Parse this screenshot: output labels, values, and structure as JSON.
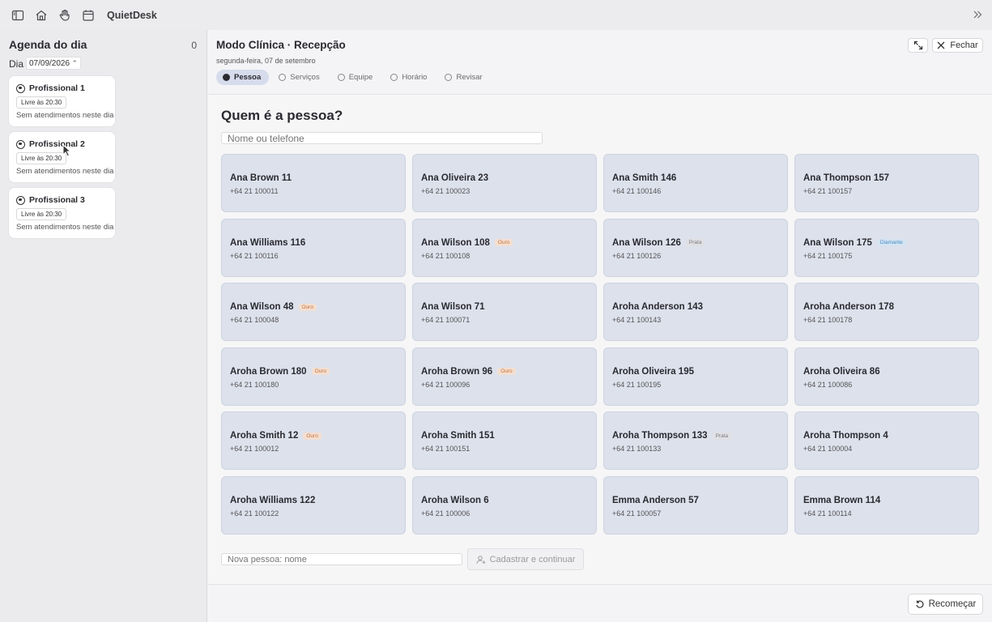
{
  "app": {
    "name": "QuietDesk"
  },
  "topbar_icons": [
    "sidebar-toggle-icon",
    "home-icon",
    "hand-icon",
    "calendar-icon",
    "chevrons-right-icon"
  ],
  "sidebar": {
    "title": "Agenda do dia",
    "count": "0",
    "day_label": "Dia",
    "day_value": "07/09/2026",
    "professionals": [
      {
        "name": "Profissional 1",
        "badge": "Livre às 20:30",
        "status": "Sem atendimentos neste dia"
      },
      {
        "name": "Profissional 2",
        "badge": "Livre às 20:30",
        "status": "Sem atendimentos neste dia"
      },
      {
        "name": "Profissional 3",
        "badge": "Livre às 20:30",
        "status": "Sem atendimentos neste dia"
      }
    ]
  },
  "main": {
    "title": "Modo Clínica · Recepção",
    "date": "segunda-feira, 07 de setembro",
    "close_label": "Fechar",
    "steps": [
      {
        "label": "Pessoa",
        "active": true
      },
      {
        "label": "Serviços",
        "active": false
      },
      {
        "label": "Equipe",
        "active": false
      },
      {
        "label": "Horário",
        "active": false
      },
      {
        "label": "Revisar",
        "active": false
      }
    ],
    "question": "Quem é a pessoa?",
    "search_placeholder": "Nome ou telefone",
    "people": [
      {
        "name": "Ana Brown 11",
        "phone": "+64 21 100011",
        "tier": ""
      },
      {
        "name": "Ana Oliveira 23",
        "phone": "+64 21 100023",
        "tier": ""
      },
      {
        "name": "Ana Smith 146",
        "phone": "+64 21 100146",
        "tier": ""
      },
      {
        "name": "Ana Thompson 157",
        "phone": "+64 21 100157",
        "tier": ""
      },
      {
        "name": "Ana Williams 116",
        "phone": "+64 21 100116",
        "tier": ""
      },
      {
        "name": "Ana Wilson 108",
        "phone": "+64 21 100108",
        "tier": "Ouro"
      },
      {
        "name": "Ana Wilson 126",
        "phone": "+64 21 100126",
        "tier": "Prata"
      },
      {
        "name": "Ana Wilson 175",
        "phone": "+64 21 100175",
        "tier": "Diamante"
      },
      {
        "name": "Ana Wilson 48",
        "phone": "+64 21 100048",
        "tier": "Ouro"
      },
      {
        "name": "Ana Wilson 71",
        "phone": "+64 21 100071",
        "tier": ""
      },
      {
        "name": "Aroha Anderson 143",
        "phone": "+64 21 100143",
        "tier": ""
      },
      {
        "name": "Aroha Anderson 178",
        "phone": "+64 21 100178",
        "tier": ""
      },
      {
        "name": "Aroha Brown 180",
        "phone": "+64 21 100180",
        "tier": "Ouro"
      },
      {
        "name": "Aroha Brown 96",
        "phone": "+64 21 100096",
        "tier": "Ouro"
      },
      {
        "name": "Aroha Oliveira 195",
        "phone": "+64 21 100195",
        "tier": ""
      },
      {
        "name": "Aroha Oliveira 86",
        "phone": "+64 21 100086",
        "tier": ""
      },
      {
        "name": "Aroha Smith 12",
        "phone": "+64 21 100012",
        "tier": "Ouro"
      },
      {
        "name": "Aroha Smith 151",
        "phone": "+64 21 100151",
        "tier": ""
      },
      {
        "name": "Aroha Thompson 133",
        "phone": "+64 21 100133",
        "tier": "Prata"
      },
      {
        "name": "Aroha Thompson 4",
        "phone": "+64 21 100004",
        "tier": ""
      },
      {
        "name": "Aroha Williams 122",
        "phone": "+64 21 100122",
        "tier": ""
      },
      {
        "name": "Aroha Wilson 6",
        "phone": "+64 21 100006",
        "tier": ""
      },
      {
        "name": "Emma Anderson 57",
        "phone": "+64 21 100057",
        "tier": ""
      },
      {
        "name": "Emma Brown 114",
        "phone": "+64 21 100114",
        "tier": ""
      }
    ],
    "new_person_placeholder": "Nova pessoa: nome",
    "register_label": "Cadastrar e continuar",
    "restart_label": "Recomeçar"
  }
}
